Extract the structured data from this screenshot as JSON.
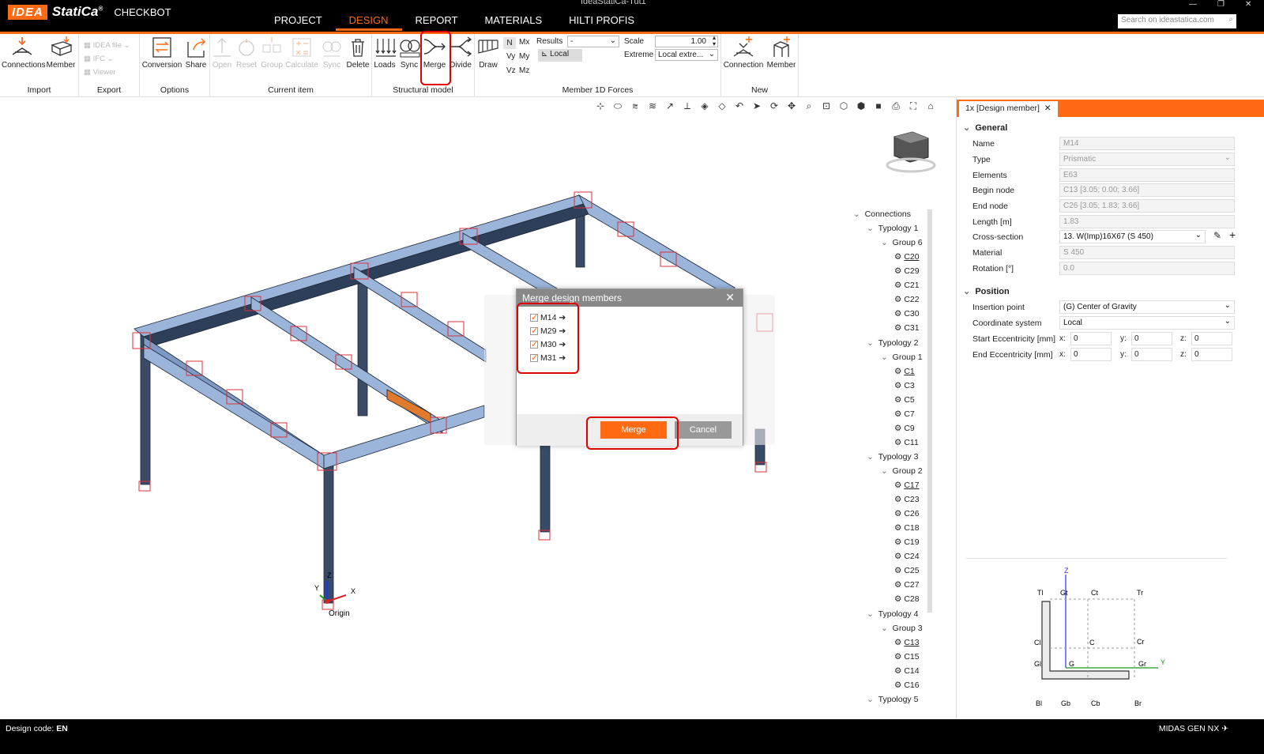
{
  "app": {
    "window_title": "IdeaStatiCa-Tut1",
    "logo_idea": "IDEA",
    "logo_statica": "StatiCa",
    "logo_reg": "®",
    "logo_product": "CHECKBOT",
    "search_placeholder": "Search on ideastatica.com",
    "menu": [
      "PROJECT",
      "DESIGN",
      "REPORT",
      "MATERIALS",
      "HILTI PROFIS"
    ],
    "active_menu": "DESIGN"
  },
  "ribbon": {
    "import": {
      "label": "Import",
      "connections": "Connections",
      "member": "Member"
    },
    "export": {
      "label": "Export",
      "idea_file": "IDEA file",
      "ifc": "IFC",
      "viewer": "Viewer"
    },
    "options": {
      "label": "Options",
      "conversion": "Conversion",
      "share": "Share"
    },
    "current_item": {
      "label": "Current item",
      "open": "Open",
      "reset": "Reset",
      "group": "Group",
      "calculate": "Calculate",
      "sync": "Sync",
      "delete": "Delete"
    },
    "structural_model": {
      "label": "Structural model",
      "loads": "Loads",
      "sync": "Sync",
      "merge": "Merge",
      "divide": "Divide"
    },
    "forces": {
      "label": "Member 1D Forces",
      "draw": "Draw",
      "n": "N",
      "mx": "Mx",
      "vy": "Vy",
      "my": "My",
      "vz": "Vz",
      "mz": "Mz",
      "results_label": "Results",
      "results_value": "-",
      "local": "Local",
      "scale_label": "Scale",
      "scale_value": "1.00",
      "extreme_label": "Extreme",
      "extreme_value": "Local extre..."
    },
    "new": {
      "label": "New",
      "connection": "Connection",
      "member": "Member"
    }
  },
  "dialog": {
    "title": "Merge design members",
    "items": [
      "M14",
      "M29",
      "M30",
      "M31"
    ],
    "arrow": "➔",
    "merge": "Merge",
    "cancel": "Cancel"
  },
  "viewport": {
    "origin_label": "Origin",
    "axis_x": "X",
    "axis_y": "Y",
    "axis_z": "Z"
  },
  "tree": {
    "root": "Connections",
    "typology1": "Typology 1",
    "group6": "Group 6",
    "t1": [
      "C20",
      "C29",
      "C21",
      "C22",
      "C30",
      "C31"
    ],
    "typology2": "Typology 2",
    "group1": "Group 1",
    "t2": [
      "C1",
      "C3",
      "C5",
      "C7",
      "C9",
      "C11"
    ],
    "typology3": "Typology 3",
    "group2": "Group 2",
    "t3": [
      "C17",
      "C23",
      "C26",
      "C18",
      "C19",
      "C24",
      "C25",
      "C27",
      "C28"
    ],
    "typology4": "Typology 4",
    "group3": "Group 3",
    "t4": [
      "C13",
      "C15",
      "C14",
      "C16"
    ],
    "typology5": "Typology 5"
  },
  "panel": {
    "tab": "1x [Design member]",
    "general": "General",
    "rows": [
      {
        "k": "Name",
        "v": "M14"
      },
      {
        "k": "Type",
        "v": "Prismatic"
      },
      {
        "k": "Elements",
        "v": "E63"
      },
      {
        "k": "Begin node",
        "v": "C13 [3.05; 0.00; 3.66]"
      },
      {
        "k": "End node",
        "v": "C26 [3.05; 1.83; 3.66]"
      },
      {
        "k": "Length [m]",
        "v": "1.83"
      },
      {
        "k": "Cross-section",
        "v": "13. W(Imp)16X67 (S 450)"
      },
      {
        "k": "Material",
        "v": "S 450"
      },
      {
        "k": "Rotation [°]",
        "v": "0.0"
      }
    ],
    "position": "Position",
    "insertion_label": "Insertion point",
    "insertion_value": "(G) Center of Gravity",
    "coord_label": "Coordinate system",
    "coord_value": "Local",
    "start_ecc": "Start Eccentricity [mm]",
    "end_ecc": "End  Eccentricity [mm]",
    "ecc_zero": "0",
    "section_labels": {
      "tl": "Tl",
      "gt": "Gt",
      "ct": "Ct",
      "tr": "Tr",
      "cl": "Cl",
      "c": "C",
      "cr": "Cr",
      "gl": "Gl",
      "g": "G",
      "gr": "Gr",
      "bl": "Bl",
      "gb": "Gb",
      "cb": "Cb",
      "br": "Br",
      "y": "Y",
      "z": "Z"
    }
  },
  "status": {
    "design_code_label": "Design code:",
    "design_code": "EN",
    "right": "MIDAS GEN NX"
  },
  "colors": {
    "accent": "#ff6a13",
    "highlight": "#e10000",
    "beam_top": "#9ab4da",
    "beam_side": "#2e3f5a"
  }
}
